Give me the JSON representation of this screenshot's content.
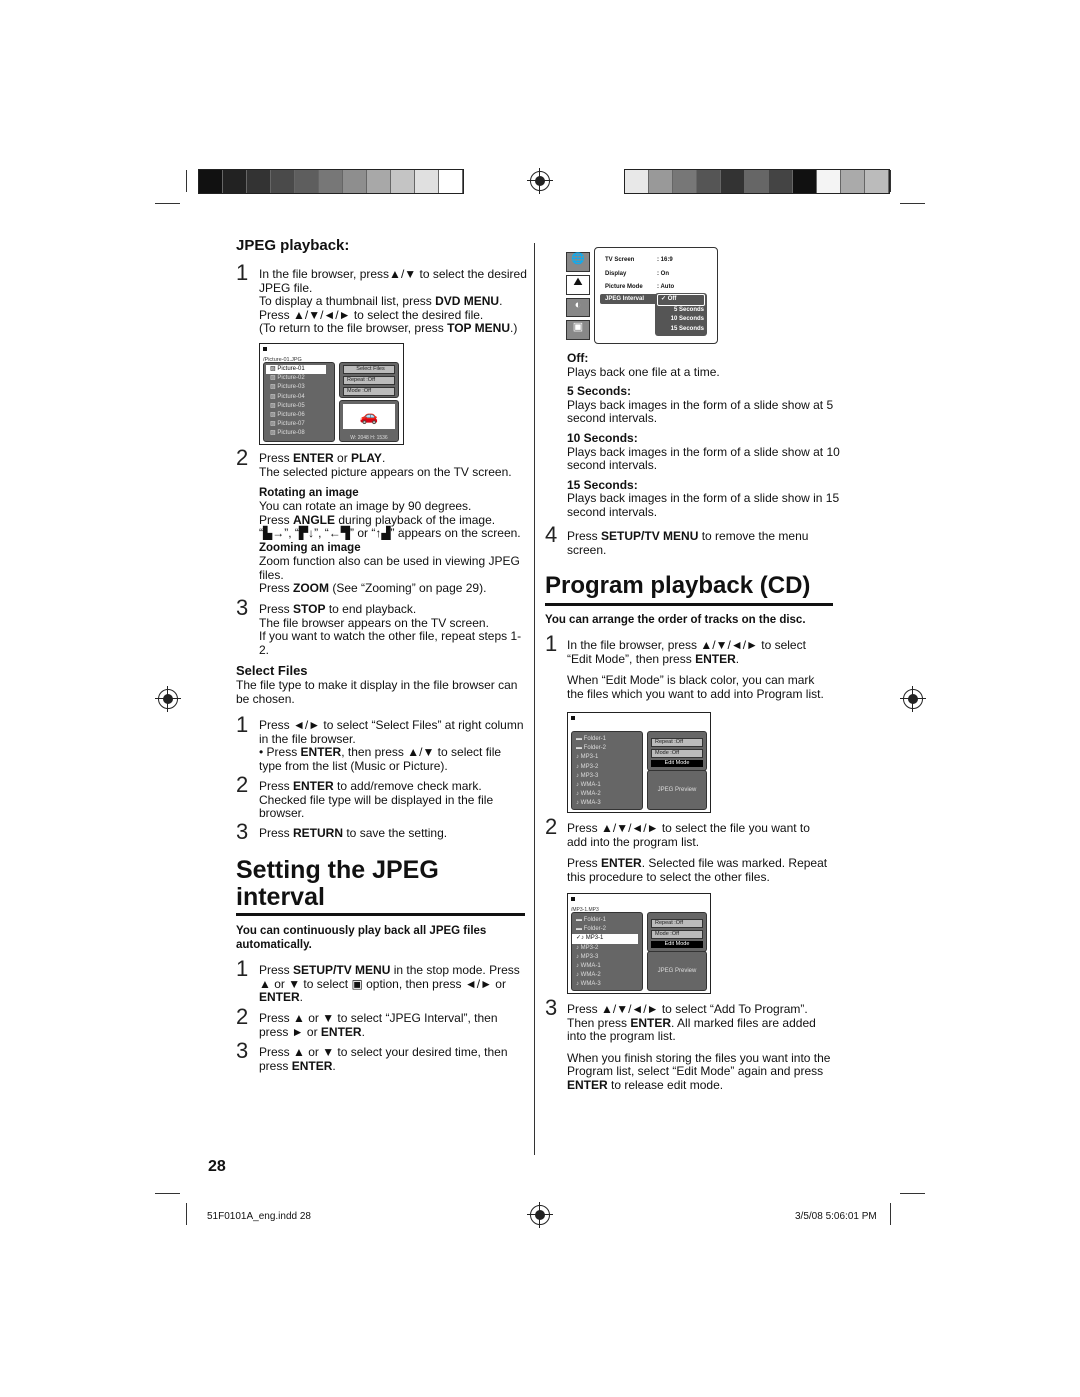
{
  "left": {
    "jpeg_heading": "JPEG playback:",
    "s1": [
      [
        {
          "t": "In the file browser, press▲/▼ to select the desired JPEG file."
        }
      ],
      [
        {
          "t": "To display a thumbnail list, press "
        },
        {
          "t": "DVD MENU",
          "b": 1
        },
        {
          "t": ". Press ▲/▼/◄/► to select the desired file."
        }
      ],
      [
        {
          "t": "(To return to the file browser, press "
        },
        {
          "t": "TOP MENU",
          "b": 1
        },
        {
          "t": ".)"
        }
      ]
    ],
    "browser": {
      "path": "/Picture-01.JPG",
      "files": [
        "Picture-01",
        "Picture-02",
        "Picture-03",
        "Picture-04",
        "Picture-05",
        "Picture-06",
        "Picture-07",
        "Picture-08"
      ],
      "select_files": "Select Files",
      "repeat": "Repeat    :Off",
      "mode": "Mode       :Off",
      "size": "W: 2048  H: 1536"
    },
    "s2": [
      [
        {
          "t": "Press "
        },
        {
          "t": "ENTER",
          "b": 1
        },
        {
          "t": " or "
        },
        {
          "t": "PLAY",
          "b": 1
        },
        {
          "t": "."
        }
      ],
      [
        {
          "t": "The selected picture appears on the TV screen."
        }
      ]
    ],
    "rotating_title": "Rotating an image",
    "rotating": [
      [
        {
          "t": "You can rotate an image by 90 degrees."
        }
      ],
      [
        {
          "t": "Press "
        },
        {
          "t": "ANGLE",
          "b": 1
        },
        {
          "t": " during playback of the image."
        }
      ],
      [
        {
          "t": "“▙→”, “▛↓”, “←▜” or “↑▟” appears on the screen."
        }
      ]
    ],
    "zooming_title": "Zooming an image",
    "zooming": [
      [
        {
          "t": "Zoom function also can be used in viewing JPEG files."
        }
      ],
      [
        {
          "t": "Press "
        },
        {
          "t": "ZOOM",
          "b": 1
        },
        {
          "t": " (See “Zooming” on page 29)."
        }
      ]
    ],
    "s3": [
      [
        {
          "t": "Press "
        },
        {
          "t": "STOP",
          "b": 1
        },
        {
          "t": " to end playback."
        }
      ],
      [
        {
          "t": "The file browser appears on the TV screen."
        }
      ],
      [
        {
          "t": "If you want to watch the other file, repeat steps 1-2."
        }
      ]
    ],
    "select_files_heading": "Select Files",
    "select_files_intro": "The file type to make it display in the file browser can be chosen.",
    "sf1": [
      [
        {
          "t": "Press ◄/► to select “Select Files” at right column in the file browser."
        }
      ],
      [
        {
          "t": "• Press "
        },
        {
          "t": "ENTER",
          "b": 1
        },
        {
          "t": ", then press ▲/▼ to select file type from the list (Music or Picture)."
        }
      ]
    ],
    "sf2": [
      [
        {
          "t": "Press "
        },
        {
          "t": "ENTER",
          "b": 1
        },
        {
          "t": " to add/remove check mark. Checked file type will be displayed in the file browser."
        }
      ]
    ],
    "sf3": [
      [
        {
          "t": "Press "
        },
        {
          "t": "RETURN",
          "b": 1
        },
        {
          "t": " to save the setting."
        }
      ]
    ],
    "interval_heading": "Setting the JPEG interval",
    "interval_intro": "You can continuously play back all JPEG files automatically.",
    "i1": [
      [
        {
          "t": "Press "
        },
        {
          "t": "SETUP/TV MENU",
          "b": 1
        },
        {
          "t": " in the stop mode. Press ▲ or ▼ to select ▣ option, then press ◄/► or "
        },
        {
          "t": "ENTER",
          "b": 1
        },
        {
          "t": "."
        }
      ]
    ],
    "i2": [
      [
        {
          "t": "Press ▲ or ▼ to select “JPEG Interval”, then press ► or "
        },
        {
          "t": "ENTER",
          "b": 1
        },
        {
          "t": "."
        }
      ]
    ],
    "i3": [
      [
        {
          "t": "Press ▲ or ▼ to select your desired time, then press "
        },
        {
          "t": "ENTER",
          "b": 1
        },
        {
          "t": "."
        }
      ]
    ],
    "page_number": "28"
  },
  "right": {
    "menu": {
      "rows": [
        [
          "TV Screen",
          ": 16:9"
        ],
        [
          "Display",
          ": On"
        ],
        [
          "Picture Mode",
          ": Auto"
        ]
      ],
      "selected": "JPEG Interval",
      "options": [
        "✓ Off",
        "5 Seconds",
        "10 Seconds",
        "15 Seconds"
      ]
    },
    "options": [
      {
        "title": "Off:",
        "desc": "Plays back one file at a time."
      },
      {
        "title": "5 Seconds:",
        "desc": "Plays back images in the form of a slide show at 5 second intervals."
      },
      {
        "title": "10 Seconds:",
        "desc": "Plays back images in the form of a slide show at 10 second intervals."
      },
      {
        "title": "15 Seconds:",
        "desc": "Plays back images in the form of a slide show in 15 second intervals."
      }
    ],
    "s4": [
      [
        {
          "t": "Press "
        },
        {
          "t": "SETUP/TV MENU",
          "b": 1
        },
        {
          "t": " to remove the menu screen."
        }
      ]
    ],
    "program_heading": "Program playback (CD)",
    "program_intro": "You can arrange the order of tracks on the disc.",
    "p1": [
      [
        {
          "t": "In the file browser, press ▲/▼/◄/► to select “Edit Mode”, then press "
        },
        {
          "t": "ENTER",
          "b": 1
        },
        {
          "t": "."
        }
      ],
      [
        {
          "t": "When “Edit Mode” is black color, you can mark the files which you want to add into Program list."
        }
      ]
    ],
    "p2": [
      [
        {
          "t": "Press ▲/▼/◄/► to select the file you want to add into the program list."
        }
      ],
      [
        {
          "t": "Press "
        },
        {
          "t": "ENTER",
          "b": 1
        },
        {
          "t": ". Selected file was marked. Repeat this procedure to select the other files."
        }
      ]
    ],
    "p3": [
      [
        {
          "t": "Press ▲/▼/◄/► to select “Add To Program”. Then press "
        },
        {
          "t": "ENTER",
          "b": 1
        },
        {
          "t": ". All marked files are added into the program list."
        }
      ],
      [
        {
          "t": "When you finish storing the files you want into the Program list, select “Edit Mode” again and press "
        },
        {
          "t": "ENTER",
          "b": 1
        },
        {
          "t": " to release edit mode."
        }
      ]
    ],
    "browser2": {
      "path": "/MP3-1.MP3",
      "files": [
        "Folder-1",
        "Folder-2",
        "MP3-1",
        "MP3-2",
        "MP3-3",
        "WMA-1",
        "WMA-2",
        "WMA-3"
      ],
      "repeat": "Repeat    :Off",
      "mode": "Mode       :Off",
      "edit": "Edit Mode",
      "preview": "JPEG Preview"
    }
  },
  "footer": {
    "file": "51F0101A_eng.indd   28",
    "date": "3/5/08   5:06:01 PM"
  }
}
